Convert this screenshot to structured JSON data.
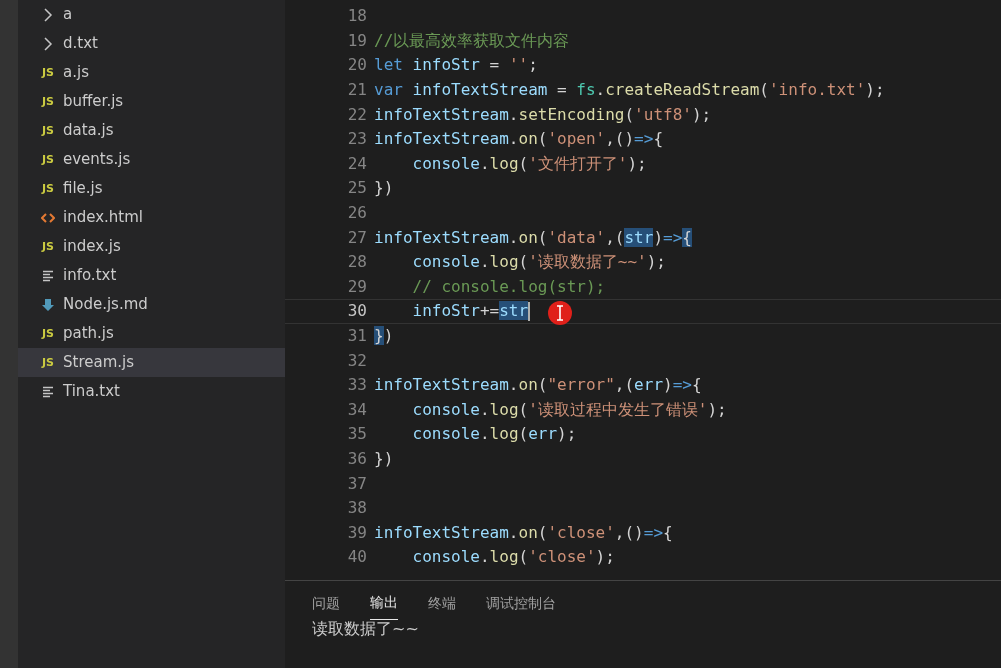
{
  "explorer": {
    "items": [
      {
        "name": "a",
        "kind": "folder",
        "selected": false
      },
      {
        "name": "d.txt",
        "kind": "folder",
        "selected": false
      },
      {
        "name": "a.js",
        "kind": "js",
        "icon_text": "JS",
        "selected": false
      },
      {
        "name": "buffer.js",
        "kind": "js",
        "icon_text": "JS",
        "selected": false
      },
      {
        "name": "data.js",
        "kind": "js",
        "icon_text": "JS",
        "selected": false
      },
      {
        "name": "events.js",
        "kind": "js",
        "icon_text": "JS",
        "selected": false
      },
      {
        "name": "file.js",
        "kind": "js",
        "icon_text": "JS",
        "selected": false
      },
      {
        "name": "index.html",
        "kind": "html",
        "selected": false
      },
      {
        "name": "index.js",
        "kind": "js",
        "icon_text": "JS",
        "selected": false
      },
      {
        "name": "info.txt",
        "kind": "txt",
        "selected": false
      },
      {
        "name": "Node.js.md",
        "kind": "md",
        "selected": false
      },
      {
        "name": "path.js",
        "kind": "js",
        "icon_text": "JS",
        "selected": false
      },
      {
        "name": "Stream.js",
        "kind": "js",
        "icon_text": "JS",
        "selected": true
      },
      {
        "name": "Tina.txt",
        "kind": "txt",
        "selected": false
      }
    ]
  },
  "editor": {
    "lines": [
      {
        "number": "18",
        "current": false
      },
      {
        "number": "19",
        "current": false,
        "tokens": [
          {
            "text": "//以最高效率获取文件内容",
            "kind": "comment"
          }
        ]
      },
      {
        "number": "20",
        "current": false,
        "tokens": [
          {
            "text": "let",
            "kind": "keyword"
          },
          {
            "text": " infoStr",
            "kind": "variable"
          },
          {
            "text": " = ",
            "kind": "plain"
          },
          {
            "text": "''",
            "kind": "string"
          },
          {
            "text": ";",
            "kind": "plain"
          }
        ]
      },
      {
        "number": "21",
        "current": false,
        "tokens": [
          {
            "text": "var",
            "kind": "keyword"
          },
          {
            "text": " infoTextStream",
            "kind": "variable"
          },
          {
            "text": " = ",
            "kind": "plain"
          },
          {
            "text": "fs",
            "kind": "type"
          },
          {
            "text": ".",
            "kind": "plain"
          },
          {
            "text": "createReadStream",
            "kind": "function"
          },
          {
            "text": "(",
            "kind": "plain"
          },
          {
            "text": "'info.txt'",
            "kind": "string"
          },
          {
            "text": ");",
            "kind": "plain"
          }
        ]
      },
      {
        "number": "22",
        "current": false,
        "tokens": [
          {
            "text": "infoTextStream",
            "kind": "variable"
          },
          {
            "text": ".",
            "kind": "plain"
          },
          {
            "text": "setEncoding",
            "kind": "function"
          },
          {
            "text": "(",
            "kind": "plain"
          },
          {
            "text": "'utf8'",
            "kind": "string"
          },
          {
            "text": ");",
            "kind": "plain"
          }
        ]
      },
      {
        "number": "23",
        "current": false,
        "tokens": [
          {
            "text": "infoTextStream",
            "kind": "variable"
          },
          {
            "text": ".",
            "kind": "plain"
          },
          {
            "text": "on",
            "kind": "function"
          },
          {
            "text": "(",
            "kind": "plain"
          },
          {
            "text": "'open'",
            "kind": "string"
          },
          {
            "text": ",()",
            "kind": "plain"
          },
          {
            "text": "=>",
            "kind": "keyword"
          },
          {
            "text": "{",
            "kind": "plain"
          }
        ]
      },
      {
        "number": "24",
        "current": false,
        "tokens": [
          {
            "text": "    console",
            "kind": "variable"
          },
          {
            "text": ".",
            "kind": "plain"
          },
          {
            "text": "log",
            "kind": "function"
          },
          {
            "text": "(",
            "kind": "plain"
          },
          {
            "text": "'文件打开了'",
            "kind": "string"
          },
          {
            "text": ");",
            "kind": "plain"
          }
        ]
      },
      {
        "number": "25",
        "current": false,
        "tokens": [
          {
            "text": "})",
            "kind": "plain"
          }
        ]
      },
      {
        "number": "26",
        "current": false
      },
      {
        "number": "27",
        "current": false,
        "tokens": [
          {
            "text": "infoTextStream",
            "kind": "variable"
          },
          {
            "text": ".",
            "kind": "plain"
          },
          {
            "text": "on",
            "kind": "function"
          },
          {
            "text": "(",
            "kind": "plain"
          },
          {
            "text": "'data'",
            "kind": "string"
          },
          {
            "text": ",(",
            "kind": "plain"
          },
          {
            "text": "str",
            "kind": "variable",
            "highlighted": true
          },
          {
            "text": ")",
            "kind": "plain"
          },
          {
            "text": "=>",
            "kind": "keyword"
          },
          {
            "text": "{",
            "kind": "plain",
            "highlighted": true
          }
        ]
      },
      {
        "number": "28",
        "current": false,
        "tokens": [
          {
            "text": "    console",
            "kind": "variable"
          },
          {
            "text": ".",
            "kind": "plain"
          },
          {
            "text": "log",
            "kind": "function"
          },
          {
            "text": "(",
            "kind": "plain"
          },
          {
            "text": "'读取数据了~~'",
            "kind": "string"
          },
          {
            "text": ");",
            "kind": "plain"
          }
        ]
      },
      {
        "number": "29",
        "current": false,
        "tokens": [
          {
            "text": "    // console.log(str);",
            "kind": "comment"
          }
        ]
      },
      {
        "number": "30",
        "current": true,
        "tokens": [
          {
            "text": "    infoStr",
            "kind": "variable"
          },
          {
            "text": "+=",
            "kind": "plain"
          },
          {
            "text": "str",
            "kind": "variable",
            "highlighted": true
          }
        ]
      },
      {
        "number": "31",
        "current": false,
        "tokens": [
          {
            "text": "}",
            "kind": "plain",
            "highlighted": true
          },
          {
            "text": ")",
            "kind": "plain"
          }
        ]
      },
      {
        "number": "32",
        "current": false
      },
      {
        "number": "33",
        "current": false,
        "tokens": [
          {
            "text": "infoTextStream",
            "kind": "variable"
          },
          {
            "text": ".",
            "kind": "plain"
          },
          {
            "text": "on",
            "kind": "function"
          },
          {
            "text": "(",
            "kind": "plain"
          },
          {
            "text": "\"error\"",
            "kind": "string"
          },
          {
            "text": ",(",
            "kind": "plain"
          },
          {
            "text": "err",
            "kind": "variable"
          },
          {
            "text": ")",
            "kind": "plain"
          },
          {
            "text": "=>",
            "kind": "keyword"
          },
          {
            "text": "{",
            "kind": "plain"
          }
        ]
      },
      {
        "number": "34",
        "current": false,
        "tokens": [
          {
            "text": "    console",
            "kind": "variable"
          },
          {
            "text": ".",
            "kind": "plain"
          },
          {
            "text": "log",
            "kind": "function"
          },
          {
            "text": "(",
            "kind": "plain"
          },
          {
            "text": "'读取过程中发生了错误'",
            "kind": "string"
          },
          {
            "text": ");",
            "kind": "plain"
          }
        ]
      },
      {
        "number": "35",
        "current": false,
        "tokens": [
          {
            "text": "    console",
            "kind": "variable"
          },
          {
            "text": ".",
            "kind": "plain"
          },
          {
            "text": "log",
            "kind": "function"
          },
          {
            "text": "(",
            "kind": "plain"
          },
          {
            "text": "err",
            "kind": "variable"
          },
          {
            "text": ");",
            "kind": "plain"
          }
        ]
      },
      {
        "number": "36",
        "current": false,
        "tokens": [
          {
            "text": "})",
            "kind": "plain"
          }
        ]
      },
      {
        "number": "37",
        "current": false
      },
      {
        "number": "38",
        "current": false
      },
      {
        "number": "39",
        "current": false,
        "tokens": [
          {
            "text": "infoTextStream",
            "kind": "variable"
          },
          {
            "text": ".",
            "kind": "plain"
          },
          {
            "text": "on",
            "kind": "function"
          },
          {
            "text": "(",
            "kind": "plain"
          },
          {
            "text": "'close'",
            "kind": "string"
          },
          {
            "text": ",()",
            "kind": "plain"
          },
          {
            "text": "=>",
            "kind": "keyword"
          },
          {
            "text": "{",
            "kind": "plain"
          }
        ]
      },
      {
        "number": "40",
        "current": false,
        "tokens": [
          {
            "text": "    console",
            "kind": "variable"
          },
          {
            "text": ".",
            "kind": "plain"
          },
          {
            "text": "log",
            "kind": "function"
          },
          {
            "text": "(",
            "kind": "plain"
          },
          {
            "text": "'close'",
            "kind": "string"
          },
          {
            "text": ");",
            "kind": "plain"
          }
        ]
      }
    ]
  },
  "panel": {
    "tabs": [
      {
        "label": "问题",
        "selected": false
      },
      {
        "label": "输出",
        "selected": true
      },
      {
        "label": "终端",
        "selected": false
      },
      {
        "label": "调试控制台",
        "selected": false
      }
    ],
    "output": [
      "读取数据了~~"
    ]
  }
}
